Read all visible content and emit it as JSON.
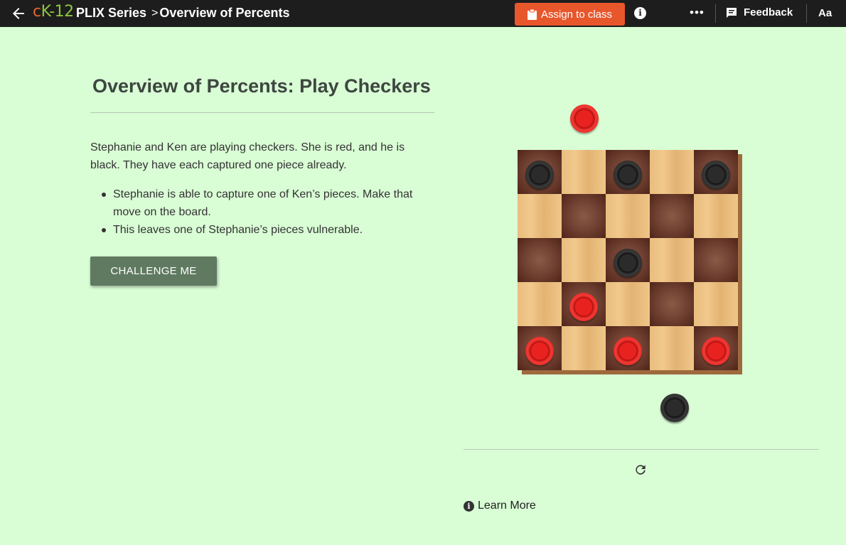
{
  "header": {
    "logo_c": "c",
    "logo_k": "K-12",
    "breadcrumb": [
      "PLIX Series",
      "Overview of Percents"
    ],
    "breadcrumb_sep": ">",
    "assign_label": "Assign to class",
    "feedback_label": "Feedback",
    "font_label": "Aa",
    "more_label": "•••",
    "info_label": "i"
  },
  "content": {
    "title": "Overview of Percents: Play Checkers",
    "intro": "Stephanie and Ken are playing checkers.  She is red, and he is black.  They have each captured one piece already.",
    "bullets": [
      "Stephanie is able to capture one of Ken’s pieces. Make that move on the board.",
      "This leaves one of Stephanie’s pieces vulnerable."
    ],
    "challenge_label": "CHALLENGE ME"
  },
  "board": {
    "size": 5,
    "cells": [
      [
        "black",
        "",
        "black",
        "",
        "black"
      ],
      [
        "",
        "",
        "",
        "",
        ""
      ],
      [
        "",
        "",
        "black",
        "",
        ""
      ],
      [
        "",
        "red",
        "",
        "",
        ""
      ],
      [
        "red",
        "",
        "red",
        "",
        "red"
      ]
    ],
    "captured": {
      "top": "red",
      "bottom": "black"
    },
    "colors": {
      "red": "#e8221f",
      "black": "#111111",
      "light_square": "#eec486",
      "dark_square": "#6d3e2f"
    }
  },
  "footer": {
    "reset_icon": "refresh-icon",
    "learn_more_label": "Learn More",
    "learn_more_icon": "info-icon"
  }
}
